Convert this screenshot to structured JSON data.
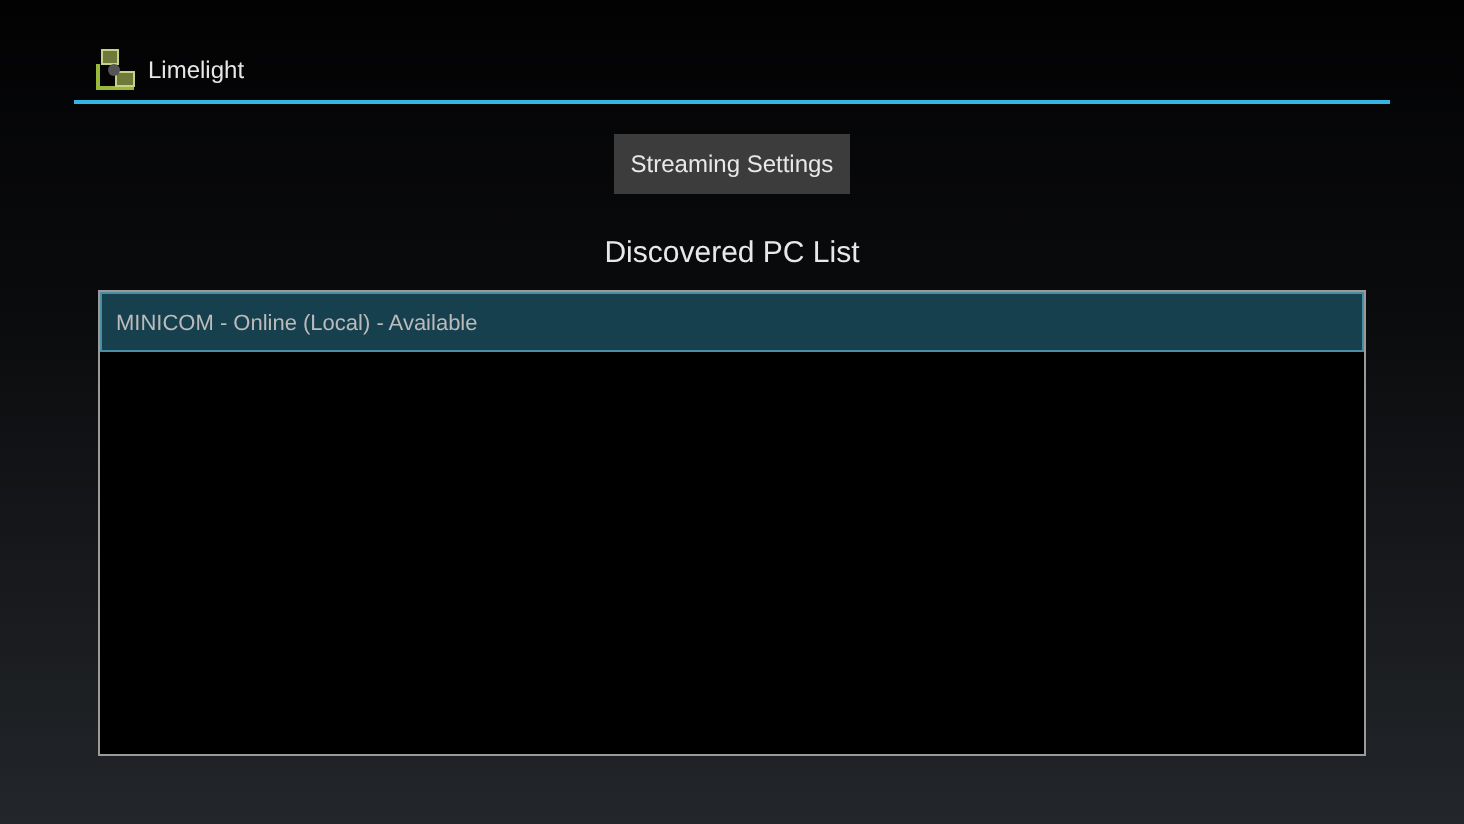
{
  "app_bar": {
    "title": "Limelight"
  },
  "settings_button": {
    "label": "Streaming Settings"
  },
  "pc_list": {
    "heading": "Discovered PC List",
    "items": [
      {
        "label": "MINICOM - Online (Local) - Available",
        "selected": true
      }
    ]
  }
}
